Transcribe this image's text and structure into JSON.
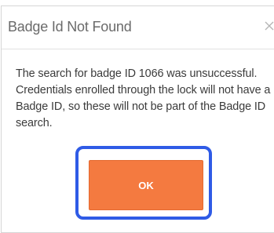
{
  "dialog": {
    "title": "Badge Id Not Found",
    "close_icon": "close-icon",
    "message": "The search for badge ID 1066 was unsuccessful. Credentials enrolled through the lock will not have a Badge ID, so these will not be part of the Badge ID search.",
    "ok_label": "OK"
  },
  "colors": {
    "accent_button": "#f47a40",
    "highlight": "#2f5be6",
    "title_text": "#6a6a6a",
    "body_text": "#3b3b3b"
  }
}
